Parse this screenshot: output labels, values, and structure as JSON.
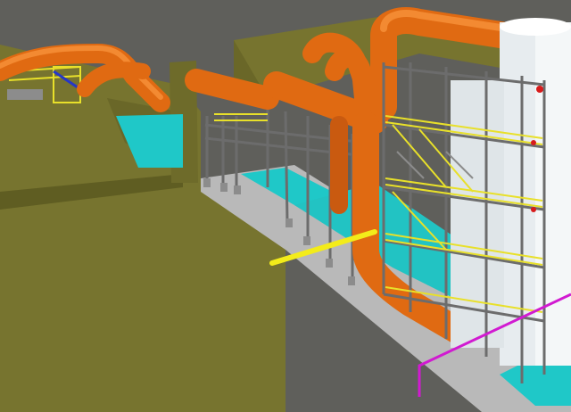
{
  "scene": {
    "kind": "3d-plant-model-viewport",
    "colors": {
      "sky": "#5f5f5b",
      "building": "#77742f",
      "building_dark": "#5f5d22",
      "building_light": "#8a8640",
      "pipe": "#e06a12",
      "pipe_dark": "#a9480a",
      "pipe_light": "#f38a32",
      "steel": "#8c8c8c",
      "steel_dark": "#5a5a5a",
      "handrail": "#e8e02a",
      "floor_cyan": "#1fc8c8",
      "floor_gray": "#b9b9b9",
      "vessel": "#e7ecef",
      "magenta_line": "#d11ad1",
      "yellow_line": "#f3ec1a",
      "blue_pipe": "#2637c7",
      "hazard_red": "#d81b1b"
    }
  }
}
